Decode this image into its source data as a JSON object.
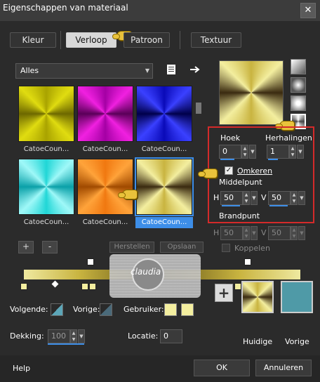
{
  "title": "Eigenschappen van materiaal",
  "close_label": "✕",
  "tabs": [
    "Kleur",
    "Verloop",
    "Patroon",
    "Textuur"
  ],
  "list": {
    "dropdown": "Alles",
    "swatches": [
      {
        "label": "CatoeCoun...",
        "colors": [
          "#a9a300",
          "#e0dc10",
          "#6d6800"
        ]
      },
      {
        "label": "CatoeCoun...",
        "colors": [
          "#a400a4",
          "#f020e0",
          "#5a0058"
        ]
      },
      {
        "label": "CatoeCoun...",
        "colors": [
          "#0a0ab8",
          "#3a40ff",
          "#00004a"
        ]
      },
      {
        "label": "CatoeCoun...",
        "colors": [
          "#20d6d6",
          "#9ff8f8",
          "#0aa0a8"
        ]
      },
      {
        "label": "CatoeCoun...",
        "colors": [
          "#f07810",
          "#ffa33a",
          "#a04a00"
        ]
      },
      {
        "label": "CatoeCoun...",
        "colors": [
          "#c9b440",
          "#f3ee9f",
          "#3a2a10"
        ]
      }
    ],
    "add": "+",
    "remove": "-"
  },
  "buttons": {
    "herstellen": "Herstellen",
    "opslaan": "Opslaan"
  },
  "settings": {
    "hoek_label": "Hoek",
    "hoek": "0",
    "herhalingen_label": "Herhalingen",
    "herhalingen": "1",
    "omkeren_label": "Omkeren",
    "omkeren_checked": "✓",
    "middelpunt_label": "Middelpunt",
    "h_label": "H",
    "v_label": "V",
    "mid_h": "50",
    "mid_v": "50",
    "brandpunt_label": "Brandpunt",
    "brand_h": "50",
    "brand_v": "50",
    "koppelen_label": "Koppelen"
  },
  "watermark": "claudia",
  "bottom": {
    "volgende": "Volgende:",
    "vorige": "Vorige:",
    "gebruiker": "Gebruiker:",
    "dekking": "Dekking:",
    "dekking_val": "100",
    "locatie": "Locatie:",
    "locatie_val": "0",
    "plus": "+",
    "huidige": "Huidige",
    "vorige_sw": "Vorige"
  },
  "footer": {
    "help": "Help",
    "ok": "OK",
    "annuleren": "Annuleren"
  },
  "colors": {
    "huidige": "#c9b440",
    "vorige": "#4f9aa7",
    "accent": "#3d8ee8",
    "highlight": "#d42a2a"
  }
}
